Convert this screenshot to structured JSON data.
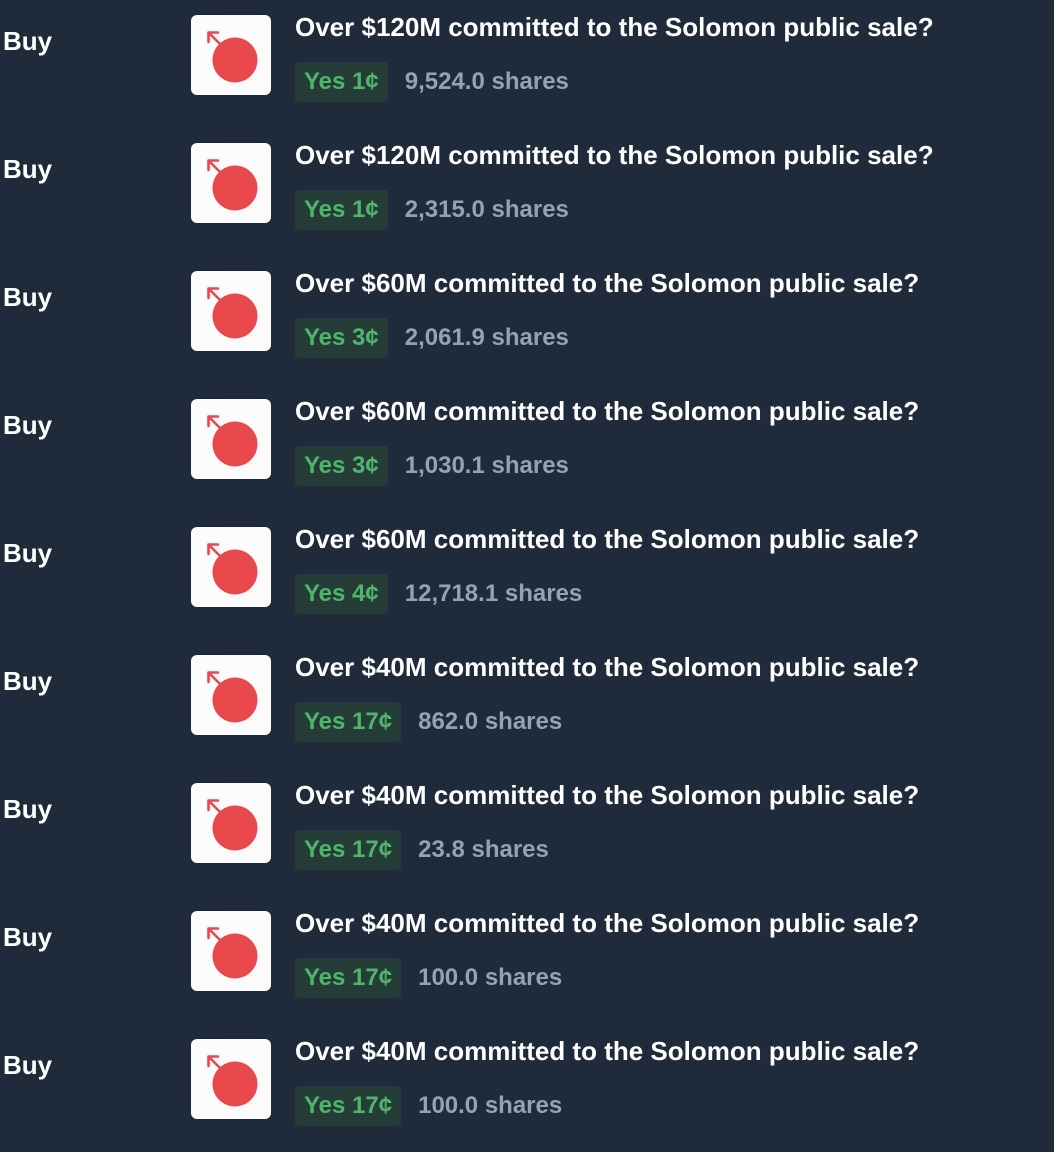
{
  "colors": {
    "background": "#1f2a3a",
    "yes_text": "#4fb56e",
    "yes_pill_bg": "#253c37",
    "shares_text": "#94a2b6",
    "logo_red": "#e9484c"
  },
  "trades": [
    {
      "side": "Buy",
      "icon": "solomon-logo-icon",
      "market": "Over $120M committed to the Solomon public sale?",
      "outcome_price": "Yes 1¢",
      "shares": "9,524.0 shares"
    },
    {
      "side": "Buy",
      "icon": "solomon-logo-icon",
      "market": "Over $120M committed to the Solomon public sale?",
      "outcome_price": "Yes 1¢",
      "shares": "2,315.0 shares"
    },
    {
      "side": "Buy",
      "icon": "solomon-logo-icon",
      "market": "Over $60M committed to the Solomon public sale?",
      "outcome_price": "Yes 3¢",
      "shares": "2,061.9 shares"
    },
    {
      "side": "Buy",
      "icon": "solomon-logo-icon",
      "market": "Over $60M committed to the Solomon public sale?",
      "outcome_price": "Yes 3¢",
      "shares": "1,030.1 shares"
    },
    {
      "side": "Buy",
      "icon": "solomon-logo-icon",
      "market": "Over $60M committed to the Solomon public sale?",
      "outcome_price": "Yes 4¢",
      "shares": "12,718.1 shares"
    },
    {
      "side": "Buy",
      "icon": "solomon-logo-icon",
      "market": "Over $40M committed to the Solomon public sale?",
      "outcome_price": "Yes 17¢",
      "shares": "862.0 shares"
    },
    {
      "side": "Buy",
      "icon": "solomon-logo-icon",
      "market": "Over $40M committed to the Solomon public sale?",
      "outcome_price": "Yes 17¢",
      "shares": "23.8 shares"
    },
    {
      "side": "Buy",
      "icon": "solomon-logo-icon",
      "market": "Over $40M committed to the Solomon public sale?",
      "outcome_price": "Yes 17¢",
      "shares": "100.0 shares"
    },
    {
      "side": "Buy",
      "icon": "solomon-logo-icon",
      "market": "Over $40M committed to the Solomon public sale?",
      "outcome_price": "Yes 17¢",
      "shares": "100.0 shares"
    }
  ]
}
